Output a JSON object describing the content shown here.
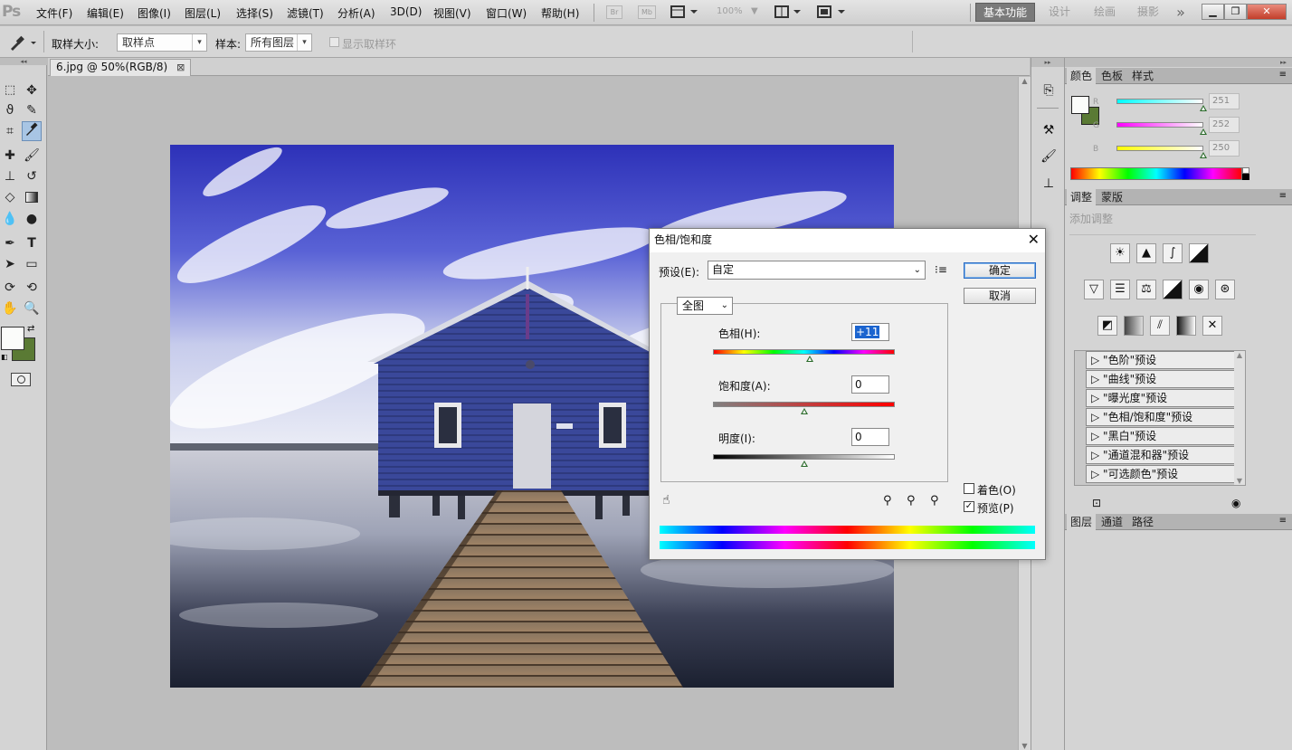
{
  "app": {
    "logo": "Ps"
  },
  "menu": [
    "文件(F)",
    "编辑(E)",
    "图像(I)",
    "图层(L)",
    "选择(S)",
    "滤镜(T)",
    "分析(A)",
    "3D(D)",
    "视图(V)",
    "窗口(W)",
    "帮助(H)"
  ],
  "menubar_right": {
    "bridge": "Br",
    "mini": "Mb",
    "zoom": "100%",
    "workspaces": [
      "基本功能",
      "设计",
      "绘画",
      "摄影"
    ],
    "more": "»"
  },
  "options": {
    "sample_size_label": "取样大小:",
    "sample_size_value": "取样点",
    "sample_label": "样本:",
    "sample_value": "所有图层",
    "show_ring_label": "显示取样环"
  },
  "document": {
    "tab_title": "6.jpg @ 50%(RGB/8)",
    "close": "⊠"
  },
  "color_panel": {
    "tabs": [
      "颜色",
      "色板",
      "样式"
    ],
    "channels": [
      {
        "label": "R",
        "value": "251"
      },
      {
        "label": "G",
        "value": "252"
      },
      {
        "label": "B",
        "value": "250"
      }
    ],
    "foreground": "#fbfcfa",
    "background": "#5a7a34"
  },
  "adjust_panel": {
    "tabs": [
      "调整",
      "蒙版"
    ],
    "heading": "添加调整",
    "presets": [
      "\"色阶\"预设",
      "\"曲线\"预设",
      "\"曝光度\"预设",
      "\"色相/饱和度\"预设",
      "\"黑白\"预设",
      "\"通道混和器\"预设",
      "\"可选颜色\"预设"
    ]
  },
  "layers_panel": {
    "tabs": [
      "图层",
      "通道",
      "路径"
    ]
  },
  "dialog": {
    "title": "色相/饱和度",
    "close": "✕",
    "preset_label": "预设(E):",
    "preset_value": "自定",
    "ok": "确定",
    "cancel": "取消",
    "range_value": "全图",
    "hue_label": "色相(H):",
    "hue_value": "+11",
    "saturation_label": "饱和度(A):",
    "saturation_value": "0",
    "lightness_label": "明度(I):",
    "lightness_value": "0",
    "colorize_label": "着色(O)",
    "preview_label": "预览(P)",
    "colorize_checked": false,
    "preview_checked": true
  }
}
